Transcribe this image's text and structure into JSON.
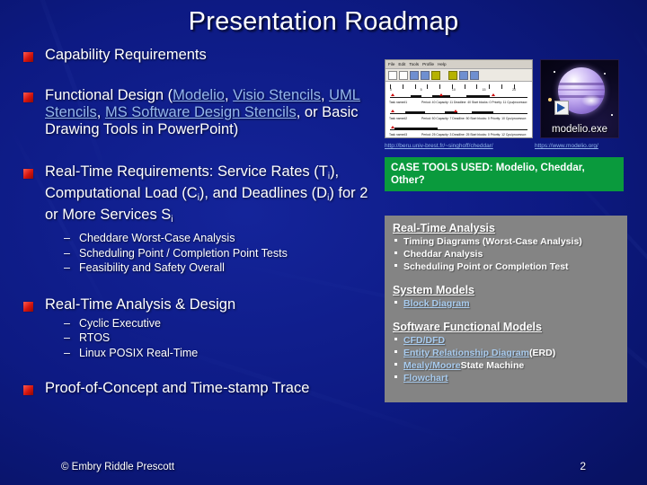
{
  "slide": {
    "title": "Presentation Roadmap",
    "page_number": "2",
    "copyright": "© Embry Riddle Prescott",
    "background_color": "#0d1a83",
    "bullet_color": "#d2140e",
    "link_color": "#95b7ec"
  },
  "bullets": [
    {
      "text": "Capability Requirements"
    },
    {
      "lead": "Functional Design (",
      "link1": "Modelio",
      "sep1": ", ",
      "link2": "Visio Stencils",
      "sep2": ", ",
      "link3": "UML Stencils",
      "sep3": ", ",
      "link4": "MS Software Design Stencils",
      "tail": ", or Basic Drawing Tools in PowerPoint)"
    },
    {
      "part1": "Real-Time Requirements: Service Rates (T",
      "sub1": "i",
      "part2": "), Computational Load (C",
      "sub2": "i",
      "part3": "), and Deadlines (D",
      "sub3": "i",
      "part4": ") for 2 or More Services S",
      "sub4": "i",
      "subitems": [
        "Cheddare Worst-Case Analysis",
        "Scheduling Point / Completion Point Tests",
        "Feasibility and Safety Overall"
      ]
    },
    {
      "text": "Real-Time Analysis & Design",
      "subitems": [
        "Cyclic Executive",
        "RTOS",
        "Linux POSIX Real-Time"
      ]
    },
    {
      "text": "Proof-of-Concept and Time-stamp Trace"
    }
  ],
  "right": {
    "cheddar_window": {
      "menus": [
        "File",
        "Edit",
        "Tools",
        "Profile",
        "Help"
      ],
      "ruler_labels": [
        "0",
        "5",
        "10",
        "15",
        "20"
      ],
      "tasks": [
        {
          "name": "Task name#1",
          "caption": "Period: 40 Capacity: 11 Deadline: 40 Start blocks: 0 Priority: 11 Cpu/processor:"
        },
        {
          "name": "Task name#2",
          "caption": "Period: 50 Capacity: 7 Deadline: 50 Start blocks: 0 Priority: 10 Cpu/processor:"
        },
        {
          "name": "Task name#3",
          "caption": "Period: 25 Capacity: 3 Deadline: 25 Start blocks: 0 Priority: 12 Cpu/processor:"
        }
      ]
    },
    "modelio_icon_label": "modelio.exe",
    "url_cheddar": "http://beru.univ-brest.fr/~singhoff/cheddar/",
    "url_modelio": "https://www.modelio.org/",
    "case_tools_note": "CASE TOOLS USED: Modelio, Cheddar, Other?",
    "case_tools_color": "#0a9a3d",
    "panel_color": "#848484",
    "sections": [
      {
        "heading": "Real-Time Analysis",
        "heading_is_link": false,
        "items": [
          {
            "link": "",
            "plain": "Timing Diagrams (Worst-Case Analysis)"
          },
          {
            "link": "",
            "plain": "Cheddar Analysis"
          },
          {
            "link": "",
            "plain": "Scheduling Point or Completion Test"
          }
        ]
      },
      {
        "heading": "System Models",
        "heading_is_link": false,
        "items": [
          {
            "link": "Block Diagram",
            "plain": ""
          }
        ]
      },
      {
        "heading": "Software Functional Models",
        "heading_is_link": false,
        "items": [
          {
            "link": "CFD/DFD",
            "plain": ""
          },
          {
            "link": "Entity Relationship Diagram",
            "plain": " (ERD)"
          },
          {
            "link": "Mealy/Moore",
            "plain": " State Machine"
          },
          {
            "link": "Flowchart",
            "plain": ""
          }
        ]
      }
    ]
  }
}
